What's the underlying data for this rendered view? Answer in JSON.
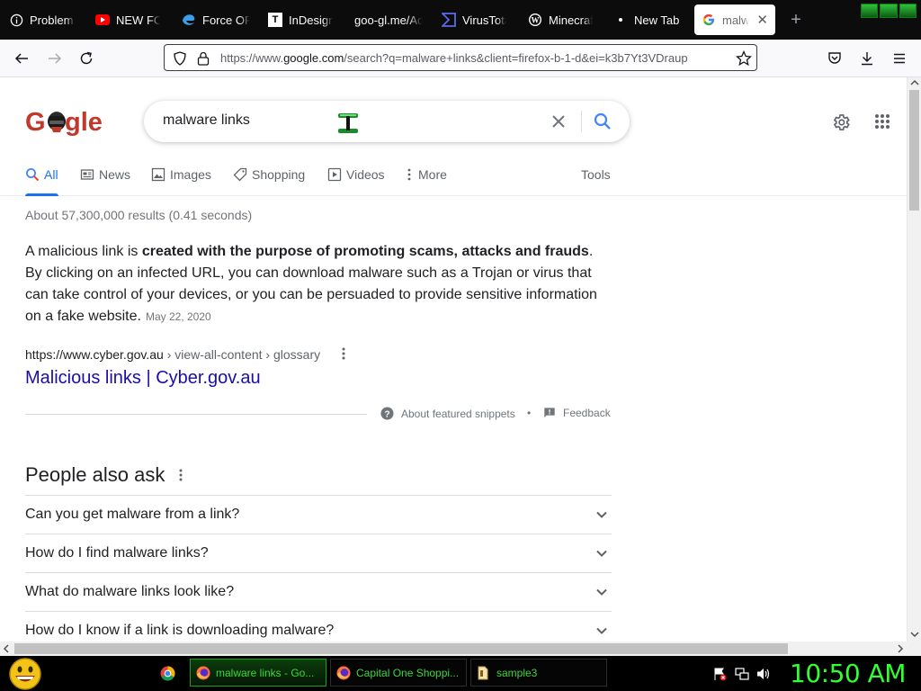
{
  "browser": {
    "tabs": [
      {
        "label": "Problem loading page",
        "icon": "info-icon"
      },
      {
        "label": "NEW FORMAT",
        "icon": "youtube-icon"
      },
      {
        "label": "Force OP",
        "icon": "edge-icon"
      },
      {
        "label": "InDesign",
        "icon": "t-logo-icon"
      },
      {
        "label": "goo-gl.me/Ad",
        "icon": ""
      },
      {
        "label": "VirusTotal",
        "icon": "virustotal-icon"
      },
      {
        "label": "Minecraft",
        "icon": "wordpress-icon"
      },
      {
        "label": "New Tab",
        "icon": "dot-icon"
      },
      {
        "label": "malware links",
        "icon": "google-icon",
        "active": true
      }
    ],
    "url_prefix": "https://www.",
    "url_domain": "google.com",
    "url_rest": "/search?q=malware+links&client=firefox-b-1-d&ei=k3b7Yt3VDraup"
  },
  "google": {
    "query": "malware links",
    "tabs": [
      "All",
      "News",
      "Images",
      "Shopping",
      "Videos",
      "More"
    ],
    "tools_label": "Tools",
    "result_stats": "About 57,300,000 results (0.41 seconds)",
    "snippet_pre": "A malicious link is ",
    "snippet_bold": "created with the purpose of promoting scams, attacks and frauds",
    "snippet_post": ". By clicking on an infected URL, you can download malware such as a Trojan or virus that can take control of your devices, or you can be persuaded to provide sensitive information on a fake website.",
    "snippet_date": "May 22, 2020",
    "cite_domain": "https://www.cyber.gov.au",
    "cite_path": " › view-all-content › glossary",
    "result_title": "Malicious links | Cyber.gov.au",
    "about_snippets": "About featured snippets",
    "bullet": "•",
    "feedback": "Feedback",
    "paa_title": "People also ask",
    "paa_questions": [
      "Can you get malware from a link?",
      "How do I find malware links?",
      "What do malware links look like?",
      "How do I know if a link is downloading malware?"
    ]
  },
  "taskbar": {
    "tasks": [
      {
        "label": "malware links - Go...",
        "active": true
      },
      {
        "label": "Capital One Shoppi..."
      },
      {
        "label": "sample3"
      }
    ],
    "clock": "10:50 AM"
  }
}
